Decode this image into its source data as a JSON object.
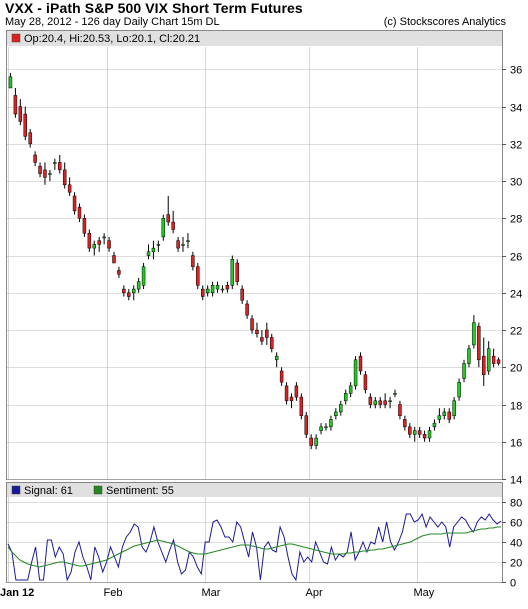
{
  "header": {
    "title": "VXX - iPath S&P 500 VIX Short Term Futures",
    "subtitle": "May 28, 2012 - 126 day  Daily Chart 15m DL",
    "credit": "(c) Stockscores Analytics"
  },
  "colors": {
    "up": "#22cc22",
    "down": "#dd2222",
    "signal": "#1a1a99",
    "sentiment": "#228822",
    "grid": "#bbbbbb",
    "legend_bg": "#e0e0e0"
  },
  "chart_data": [
    {
      "type": "candlestick",
      "legend": "Op:20.4, Hi:20.53, Lo:20.1, Cl:20.21",
      "x_tick_labels": [
        "Jan 12",
        "Feb",
        "Mar",
        "Apr",
        "May"
      ],
      "x_tick_index": [
        0,
        20,
        40,
        61,
        83
      ],
      "y_ticks": [
        14,
        16,
        18,
        20,
        22,
        24,
        26,
        28,
        30,
        32,
        34,
        36
      ],
      "ylim": [
        14,
        37.2
      ],
      "grid": true,
      "candles": [
        [
          35.0,
          35.8,
          35.0,
          35.6
        ],
        [
          34.6,
          35.0,
          33.4,
          33.6
        ],
        [
          34.0,
          34.4,
          33.0,
          33.2
        ],
        [
          33.6,
          34.0,
          32.2,
          32.4
        ],
        [
          32.6,
          32.8,
          31.8,
          32.0
        ],
        [
          31.4,
          31.6,
          30.8,
          31.0
        ],
        [
          30.8,
          31.0,
          30.2,
          30.4
        ],
        [
          30.6,
          31.0,
          29.8,
          30.2
        ],
        [
          30.4,
          30.6,
          30.0,
          30.4
        ],
        [
          31.0,
          31.2,
          30.6,
          31.0
        ],
        [
          31.0,
          31.4,
          30.4,
          30.6
        ],
        [
          30.6,
          31.0,
          29.6,
          29.8
        ],
        [
          29.8,
          30.2,
          29.2,
          29.4
        ],
        [
          29.2,
          29.4,
          28.2,
          28.4
        ],
        [
          28.6,
          28.8,
          27.8,
          28.0
        ],
        [
          28.0,
          28.2,
          27.0,
          27.2
        ],
        [
          27.2,
          27.4,
          26.2,
          26.4
        ],
        [
          26.4,
          26.8,
          26.0,
          26.6
        ],
        [
          26.8,
          27.0,
          26.2,
          26.6
        ],
        [
          27.0,
          27.2,
          26.6,
          27.0
        ],
        [
          26.8,
          27.0,
          26.2,
          26.4
        ],
        [
          26.0,
          26.2,
          25.6,
          25.6
        ],
        [
          25.2,
          25.4,
          24.8,
          25.0
        ],
        [
          24.2,
          24.4,
          23.8,
          24.0
        ],
        [
          24.0,
          24.2,
          23.6,
          23.8
        ],
        [
          24.0,
          24.4,
          23.6,
          24.2
        ],
        [
          24.2,
          24.8,
          24.0,
          24.6
        ],
        [
          24.4,
          25.6,
          24.2,
          25.4
        ],
        [
          26.0,
          26.6,
          25.8,
          26.2
        ],
        [
          26.2,
          26.8,
          25.8,
          26.4
        ],
        [
          26.6,
          26.8,
          26.2,
          26.6
        ],
        [
          27.0,
          28.2,
          26.8,
          28.0
        ],
        [
          28.2,
          29.2,
          27.6,
          27.8
        ],
        [
          27.8,
          28.4,
          27.2,
          27.4
        ],
        [
          26.8,
          27.0,
          26.2,
          26.4
        ],
        [
          26.6,
          27.0,
          26.2,
          26.6
        ],
        [
          26.8,
          27.2,
          26.4,
          26.8
        ],
        [
          26.0,
          26.2,
          25.2,
          25.4
        ],
        [
          25.4,
          25.6,
          24.2,
          24.4
        ],
        [
          24.2,
          24.4,
          23.6,
          23.8
        ],
        [
          24.0,
          24.4,
          23.8,
          24.2
        ],
        [
          24.0,
          24.6,
          23.8,
          24.4
        ],
        [
          24.2,
          24.6,
          24.0,
          24.4
        ],
        [
          24.2,
          24.4,
          24.0,
          24.2
        ],
        [
          24.4,
          24.6,
          24.0,
          24.2
        ],
        [
          24.4,
          26.0,
          24.2,
          25.8
        ],
        [
          25.6,
          25.8,
          24.4,
          24.6
        ],
        [
          24.2,
          24.4,
          23.4,
          23.6
        ],
        [
          23.4,
          23.6,
          22.6,
          22.8
        ],
        [
          22.6,
          22.8,
          21.8,
          22.0
        ],
        [
          22.0,
          22.4,
          21.6,
          21.8
        ],
        [
          21.6,
          22.0,
          21.2,
          21.4
        ],
        [
          22.0,
          22.4,
          21.2,
          21.6
        ],
        [
          21.6,
          21.8,
          20.8,
          21.0
        ],
        [
          20.4,
          20.8,
          20.0,
          20.6
        ],
        [
          19.8,
          20.0,
          19.0,
          19.2
        ],
        [
          19.0,
          19.2,
          18.0,
          18.2
        ],
        [
          18.4,
          18.6,
          17.8,
          18.2
        ],
        [
          19.0,
          19.2,
          18.2,
          18.4
        ],
        [
          18.4,
          18.6,
          17.2,
          17.4
        ],
        [
          17.4,
          17.6,
          16.2,
          16.4
        ],
        [
          16.2,
          16.4,
          15.6,
          15.8
        ],
        [
          15.8,
          16.4,
          15.6,
          16.2
        ],
        [
          16.6,
          17.0,
          16.4,
          16.8
        ],
        [
          16.8,
          17.0,
          16.6,
          16.8
        ],
        [
          16.8,
          17.4,
          16.6,
          17.2
        ],
        [
          17.4,
          17.8,
          17.2,
          17.6
        ],
        [
          17.6,
          18.2,
          17.4,
          18.0
        ],
        [
          18.2,
          18.8,
          18.0,
          18.6
        ],
        [
          18.6,
          19.2,
          18.4,
          19.0
        ],
        [
          19.0,
          20.6,
          18.8,
          20.4
        ],
        [
          20.6,
          20.8,
          19.6,
          19.8
        ],
        [
          19.6,
          19.8,
          18.6,
          18.8
        ],
        [
          18.4,
          18.6,
          17.8,
          18.0
        ],
        [
          18.0,
          18.4,
          17.8,
          18.2
        ],
        [
          18.2,
          18.4,
          17.8,
          18.0
        ],
        [
          18.2,
          18.6,
          17.8,
          18.0
        ],
        [
          18.2,
          18.4,
          17.8,
          18.2
        ],
        [
          18.6,
          18.8,
          18.4,
          18.6
        ],
        [
          18.0,
          18.2,
          17.2,
          17.4
        ],
        [
          17.2,
          17.4,
          16.6,
          16.8
        ],
        [
          16.8,
          17.0,
          16.2,
          16.4
        ],
        [
          16.4,
          16.8,
          16.0,
          16.6
        ],
        [
          16.6,
          16.8,
          16.2,
          16.4
        ],
        [
          16.4,
          16.6,
          16.0,
          16.2
        ],
        [
          16.2,
          16.8,
          16.0,
          16.6
        ],
        [
          16.8,
          17.2,
          16.6,
          17.0
        ],
        [
          17.2,
          17.8,
          17.0,
          17.4
        ],
        [
          17.4,
          17.8,
          17.2,
          17.6
        ],
        [
          17.6,
          17.8,
          17.0,
          17.2
        ],
        [
          17.4,
          18.4,
          17.2,
          18.2
        ],
        [
          18.4,
          19.4,
          18.2,
          19.2
        ],
        [
          19.4,
          20.4,
          19.2,
          20.2
        ],
        [
          20.2,
          21.2,
          20.0,
          21.0
        ],
        [
          21.2,
          22.8,
          21.0,
          22.4
        ],
        [
          22.2,
          22.4,
          20.0,
          20.4
        ],
        [
          20.6,
          21.6,
          19.0,
          19.6
        ],
        [
          19.8,
          21.4,
          19.6,
          21.0
        ],
        [
          20.6,
          21.0,
          20.0,
          20.2
        ],
        [
          20.4,
          20.53,
          20.1,
          20.21
        ]
      ]
    },
    {
      "type": "line",
      "x_tick_labels": [
        "Jan 12",
        "Feb",
        "Mar",
        "Apr",
        "May"
      ],
      "y_ticks": [
        0,
        20,
        40,
        60,
        80
      ],
      "ylim": [
        0,
        85
      ],
      "grid": true,
      "series": [
        {
          "name": "Signal",
          "legend": "Signal: 61",
          "values": [
            38,
            30,
            2,
            2,
            2,
            2,
            20,
            35,
            2,
            2,
            42,
            42,
            25,
            35,
            28,
            2,
            10,
            30,
            40,
            25,
            15,
            2,
            35,
            25,
            10,
            20,
            35,
            25,
            15,
            35,
            45,
            50,
            58,
            55,
            35,
            30,
            40,
            55,
            40,
            30,
            20,
            32,
            42,
            20,
            8,
            12,
            30,
            25,
            15,
            8,
            40,
            40,
            60,
            62,
            55,
            45,
            45,
            40,
            60,
            55,
            40,
            25,
            50,
            35,
            2,
            35,
            40,
            32,
            30,
            55,
            45,
            25,
            8,
            2,
            30,
            20,
            25,
            20,
            40,
            30,
            20,
            18,
            35,
            22,
            28,
            25,
            30,
            50,
            22,
            30,
            40,
            30,
            40,
            38,
            55,
            40,
            60,
            40,
            32,
            40,
            50,
            68,
            68,
            60,
            62,
            68,
            55,
            65,
            60,
            55,
            60,
            55,
            35,
            55,
            60,
            65,
            62,
            55,
            50,
            60,
            65,
            62,
            68,
            62,
            58,
            61
          ]
        },
        {
          "name": "Sentiment",
          "legend": "Sentiment: 55",
          "values": [
            35,
            30,
            26,
            22,
            20,
            18,
            17,
            16,
            15,
            16,
            17,
            18,
            19,
            20,
            20,
            19,
            18,
            17,
            16,
            16,
            17,
            18,
            19,
            20,
            21,
            22,
            24,
            26,
            28,
            30,
            32,
            34,
            36,
            37,
            38,
            39,
            40,
            41,
            42,
            41,
            40,
            39,
            38,
            36,
            34,
            32,
            30,
            29,
            28,
            28,
            28,
            29,
            30,
            31,
            32,
            33,
            34,
            35,
            36,
            37,
            37,
            37,
            36,
            35,
            34,
            33,
            33,
            34,
            35,
            36,
            37,
            38,
            38,
            37,
            36,
            35,
            34,
            33,
            32,
            31,
            30,
            29,
            28,
            28,
            28,
            28,
            29,
            29,
            30,
            30,
            31,
            31,
            32,
            32,
            33,
            33,
            34,
            35,
            36,
            37,
            38,
            39,
            40,
            42,
            44,
            46,
            47,
            48,
            48,
            48,
            48,
            49,
            49,
            49,
            49,
            49,
            49,
            50,
            51,
            52,
            53,
            53,
            54,
            54,
            55,
            55
          ]
        }
      ]
    }
  ]
}
